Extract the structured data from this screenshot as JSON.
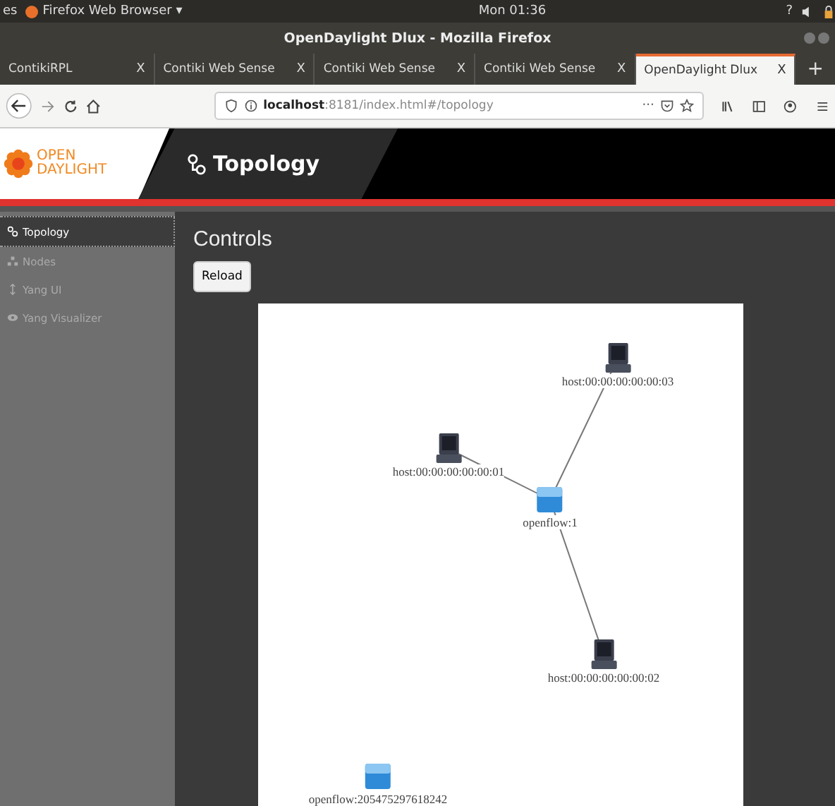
{
  "top_bar": {
    "activities": "es",
    "app_menu": "Firefox Web Browser ▾",
    "clock": "Mon 01:36",
    "help": "?"
  },
  "window": {
    "title": "OpenDaylight Dlux - Mozilla Firefox"
  },
  "tabs": [
    {
      "label": "ContikiRPL",
      "close": "X",
      "selected": false
    },
    {
      "label": "Contiki Web Sense",
      "close": "X",
      "selected": false
    },
    {
      "label": "Contiki Web Sense",
      "close": "X",
      "selected": false
    },
    {
      "label": "Contiki Web Sense",
      "close": "X",
      "selected": false
    },
    {
      "label": "OpenDaylight Dlux",
      "close": "X",
      "selected": true
    }
  ],
  "new_tab": "+",
  "address_bar": {
    "url": "**localhost**:8181/index.html#/topology",
    "more": "···"
  },
  "header": {
    "logo_top": "OPEN",
    "logo_bottom": "DAYLIGHT",
    "title": "Topology"
  },
  "sidebar": {
    "items": [
      {
        "label": "Topology",
        "selected": true
      },
      {
        "label": "Nodes",
        "selected": false
      },
      {
        "label": "Yang UI",
        "selected": false
      },
      {
        "label": "Yang Visualizer",
        "selected": false
      }
    ]
  },
  "controls": {
    "heading": "Controls",
    "reload_button": "Reload"
  },
  "topology": {
    "nodes": [
      {
        "kind": "host",
        "label": "host:00:00:00:00:00:03"
      },
      {
        "kind": "host",
        "label": "host:00:00:00:00:00:01"
      },
      {
        "kind": "switch",
        "label": "openflow:1"
      },
      {
        "kind": "host",
        "label": "host:00:00:00:00:00:02"
      },
      {
        "kind": "switch",
        "label": "openflow:205475297618242"
      }
    ]
  }
}
